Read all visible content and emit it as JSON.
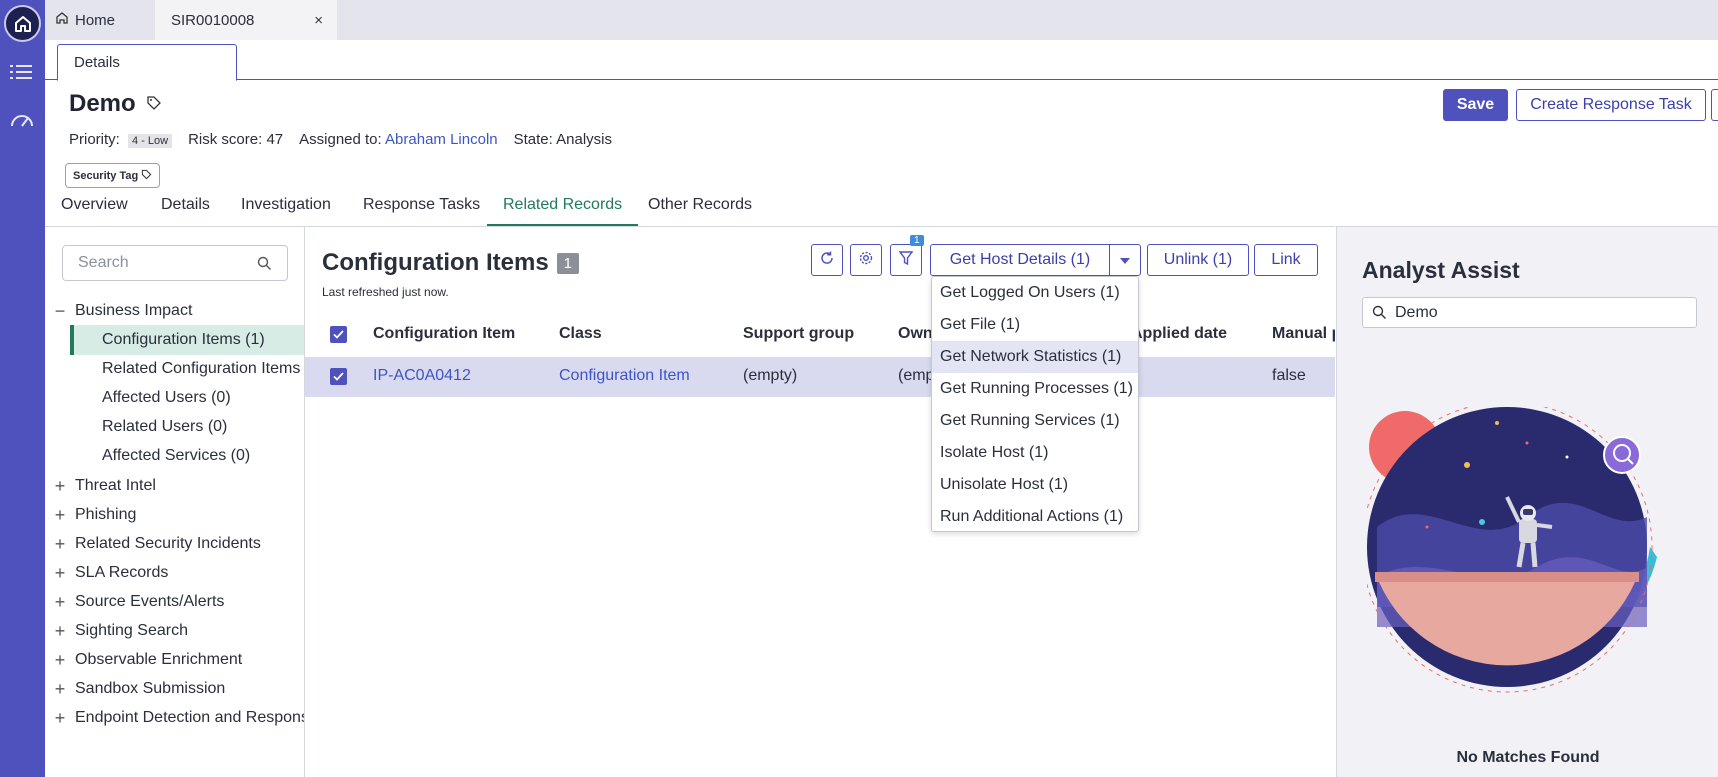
{
  "top_tabs": {
    "home_label": "Home",
    "record_label": "SIR0010008",
    "close": "×"
  },
  "sub_tab": {
    "label": "Details"
  },
  "header": {
    "title": "Demo",
    "priority_label": "Priority:",
    "priority_value": "4 - Low",
    "risk_score": "Risk score: 47",
    "assigned_label": "Assigned to:",
    "assigned_value": "Abraham Lincoln",
    "state": "State: Analysis",
    "tag_label": "Security Tag",
    "save_label": "Save",
    "create_task_label": "Create Response Task"
  },
  "record_tabs": [
    "Overview",
    "Details",
    "Investigation",
    "Response Tasks",
    "Related Records",
    "Other Records"
  ],
  "active_record_tab": "Related Records",
  "left_panel": {
    "search_placeholder": "Search",
    "tree": [
      {
        "label": "Business Impact",
        "expanded": true,
        "children": [
          "Configuration Items (1)",
          "Related Configuration Items (",
          "Affected Users (0)",
          "Related Users (0)",
          "Affected Services (0)"
        ]
      },
      {
        "label": "Threat Intel"
      },
      {
        "label": "Phishing"
      },
      {
        "label": "Related Security Incidents"
      },
      {
        "label": "SLA Records"
      },
      {
        "label": "Source Events/Alerts"
      },
      {
        "label": "Sighting Search"
      },
      {
        "label": "Observable Enrichment"
      },
      {
        "label": "Sandbox Submission"
      },
      {
        "label": "Endpoint Detection and Respons"
      }
    ],
    "active_item": "Configuration Items (1)"
  },
  "center": {
    "title": "Configuration Items",
    "count": "1",
    "refreshed": "Last refreshed just now.",
    "filter_badge": "1",
    "get_host_details": "Get Host Details (1)",
    "unlink": "Unlink (1)",
    "link": "Link",
    "columns": [
      "Configuration Item",
      "Class",
      "Support group",
      "Own",
      "Applied date",
      "Manual p"
    ],
    "rows": [
      {
        "item": "IP-AC0A0412",
        "class": "Configuration Item",
        "support_group": "(empty)",
        "owner": "(emp",
        "manual": "false"
      }
    ],
    "dropdown": [
      "Get Logged On Users (1)",
      "Get File (1)",
      "Get Network Statistics (1)",
      "Get Running Processes (1)",
      "Get Running Services (1)",
      "Isolate Host (1)",
      "Unisolate Host (1)",
      "Run Additional Actions (1)"
    ],
    "dropdown_highlighted": "Get Network Statistics (1)"
  },
  "analyst_assist": {
    "title": "Analyst Assist",
    "search_value": "Demo",
    "no_matches": "No Matches Found"
  },
  "colors": {
    "brand": "#4f52bd",
    "active_tab": "#217a5a",
    "link": "#3d55c4"
  }
}
